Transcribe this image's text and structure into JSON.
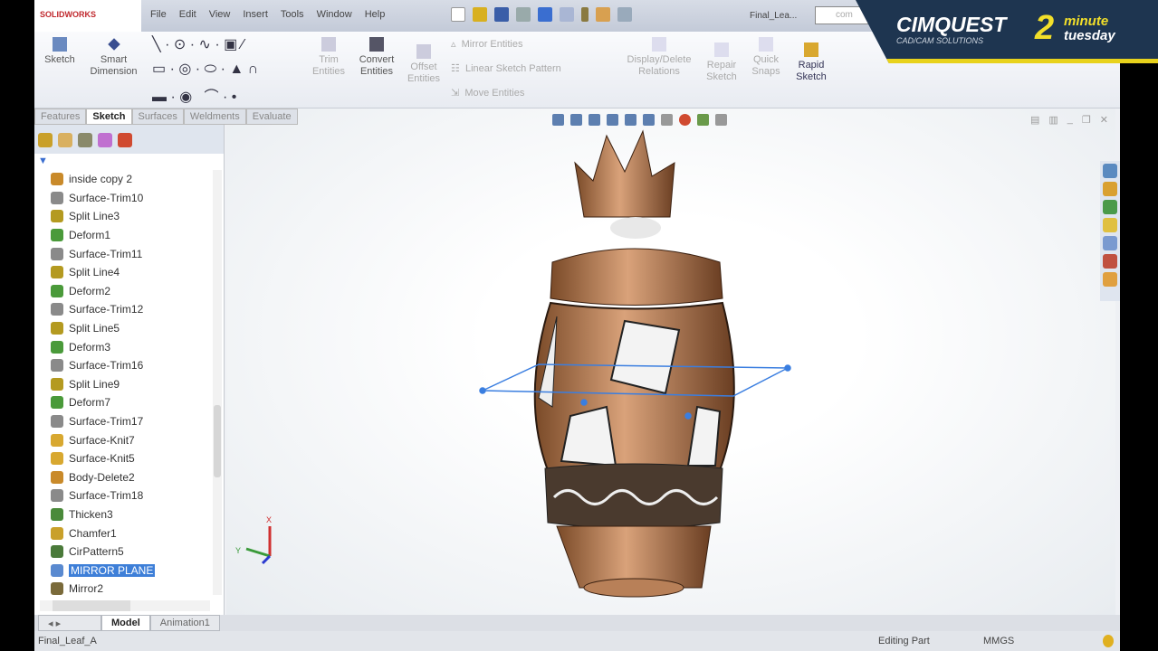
{
  "app": {
    "logo": "SOLIDWORKS",
    "file": "Final_Lea...",
    "search": "com"
  },
  "menu": [
    "File",
    "Edit",
    "View",
    "Insert",
    "Tools",
    "Window",
    "Help"
  ],
  "ribbon": {
    "sketch": "Sketch",
    "smart_dimension": "Smart Dimension",
    "trim": "Trim Entities",
    "convert": "Convert Entities",
    "offset": "Offset Entities",
    "mirror": "Mirror Entities",
    "linear_pattern": "Linear Sketch Pattern",
    "move": "Move Entities",
    "display_delete": "Display/Delete Relations",
    "repair": "Repair Sketch",
    "quick_snaps": "Quick Snaps",
    "rapid_sketch": "Rapid Sketch"
  },
  "tabs": [
    "Features",
    "Sketch",
    "Surfaces",
    "Weldments",
    "Evaluate"
  ],
  "tree": [
    {
      "label": "inside copy 2",
      "color": "#c98a2a"
    },
    {
      "label": "Surface-Trim10",
      "color": "#8a8a8a"
    },
    {
      "label": "Split Line3",
      "color": "#b49a20"
    },
    {
      "label": "Deform1",
      "color": "#4a9a3a"
    },
    {
      "label": "Surface-Trim11",
      "color": "#8a8a8a"
    },
    {
      "label": "Split Line4",
      "color": "#b49a20"
    },
    {
      "label": "Deform2",
      "color": "#4a9a3a"
    },
    {
      "label": "Surface-Trim12",
      "color": "#8a8a8a"
    },
    {
      "label": "Split Line5",
      "color": "#b49a20"
    },
    {
      "label": "Deform3",
      "color": "#4a9a3a"
    },
    {
      "label": "Surface-Trim16",
      "color": "#8a8a8a"
    },
    {
      "label": "Split Line9",
      "color": "#b49a20"
    },
    {
      "label": "Deform7",
      "color": "#4a9a3a"
    },
    {
      "label": "Surface-Trim17",
      "color": "#8a8a8a"
    },
    {
      "label": "Surface-Knit7",
      "color": "#d8a830"
    },
    {
      "label": "Surface-Knit5",
      "color": "#d8a830"
    },
    {
      "label": "Body-Delete2",
      "color": "#c98a2a"
    },
    {
      "label": "Surface-Trim18",
      "color": "#8a8a8a"
    },
    {
      "label": "Thicken3",
      "color": "#4a8a3a"
    },
    {
      "label": "Chamfer1",
      "color": "#c9a02a"
    },
    {
      "label": "CirPattern5",
      "color": "#4a7a3a"
    },
    {
      "label": "MIRROR PLANE",
      "color": "#5a8ad0",
      "selected": true
    },
    {
      "label": "Mirror2",
      "color": "#7a6a3a"
    }
  ],
  "bottom_tabs": [
    "Model",
    "Animation1"
  ],
  "status": {
    "file": "Final_Leaf_A",
    "mode": "Editing Part",
    "units": "MMGS"
  },
  "banner": {
    "brand": "CIMQUEST",
    "sub": "CAD/CAM SOLUTIONS",
    "num": "2",
    "line1": "minute",
    "line2": "tuesday"
  },
  "triad": {
    "x": "X",
    "y": "Y"
  }
}
